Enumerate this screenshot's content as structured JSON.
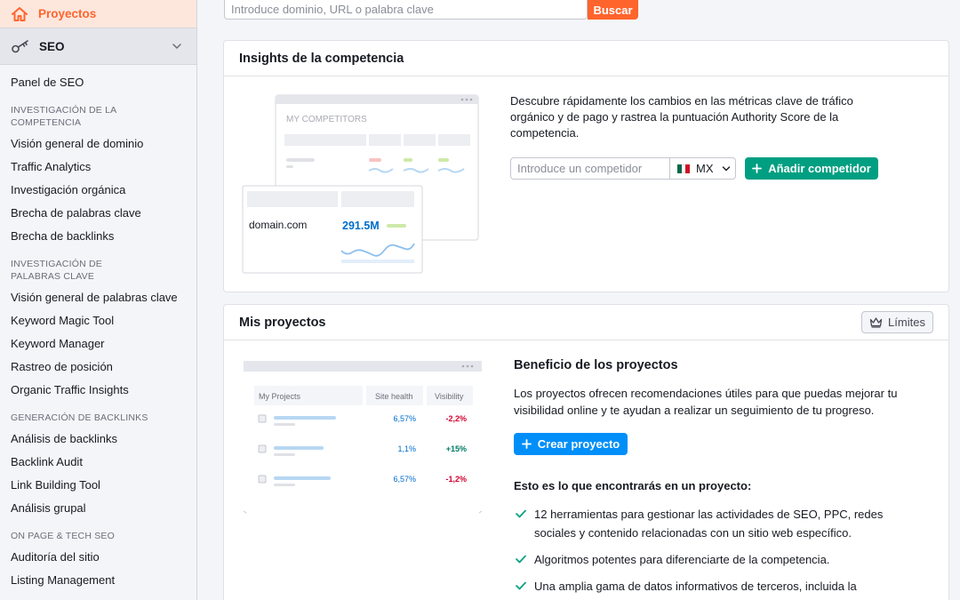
{
  "sidebar": {
    "projects_label": "Proyectos",
    "seo_label": "SEO",
    "items": [
      {
        "type": "item",
        "label": "Panel de SEO"
      },
      {
        "type": "section",
        "label": "INVESTIGACIÓN DE LA COMPETENCIA"
      },
      {
        "type": "item",
        "label": "Visión general de dominio"
      },
      {
        "type": "item",
        "label": "Traffic Analytics"
      },
      {
        "type": "item",
        "label": "Investigación orgánica"
      },
      {
        "type": "item",
        "label": "Brecha de palabras clave"
      },
      {
        "type": "item",
        "label": "Brecha de backlinks"
      },
      {
        "type": "section",
        "label": "INVESTIGACIÓN DE PALABRAS CLAVE"
      },
      {
        "type": "item",
        "label": "Visión general de palabras clave"
      },
      {
        "type": "item",
        "label": "Keyword Magic Tool"
      },
      {
        "type": "item",
        "label": "Keyword Manager"
      },
      {
        "type": "item",
        "label": "Rastreo de posición"
      },
      {
        "type": "item",
        "label": "Organic Traffic Insights"
      },
      {
        "type": "section",
        "label": "GENERACIÓN DE BACKLINKS"
      },
      {
        "type": "item",
        "label": "Análisis de backlinks"
      },
      {
        "type": "item",
        "label": "Backlink Audit"
      },
      {
        "type": "item",
        "label": "Link Building Tool"
      },
      {
        "type": "item",
        "label": "Análisis grupal"
      },
      {
        "type": "section",
        "label": "ON PAGE & TECH SEO"
      },
      {
        "type": "item",
        "label": "Auditoría del sitio"
      },
      {
        "type": "item",
        "label": "Listing Management"
      }
    ]
  },
  "search": {
    "placeholder": "Introduce dominio, URL o palabra clave",
    "button_label": "Buscar"
  },
  "insights": {
    "title": "Insights de la competencia",
    "description": "Descubre rápidamente los cambios en las métricas clave de tráfico orgánico y de pago y rastrea la puntuación Authority Score de la competencia.",
    "input_placeholder": "Introduce un competidor",
    "country": "MX",
    "add_button": "Añadir competidor",
    "illustration": {
      "header": "MY COMPETITORS",
      "domain": "domain.com",
      "value": "291.5M"
    }
  },
  "projects": {
    "title": "Mis proyectos",
    "limits_button": "Límites",
    "benefit_title": "Beneficio de los proyectos",
    "benefit_desc": "Los proyectos ofrecen recomendaciones útiles para que puedas mejorar tu visibilidad online y te ayudan a realizar un seguimiento de tu progreso.",
    "create_button": "Crear proyecto",
    "find_title": "Esto es lo que encontrarás en un proyecto:",
    "features": [
      "12 herramientas para gestionar las actividades de SEO, PPC, redes sociales y contenido relacionadas con un sitio web específico.",
      "Algoritmos potentes para diferenciarte de la competencia.",
      "Una amplia gama de datos informativos de terceros, incluida la"
    ],
    "illustration": {
      "col1": "My Projects",
      "col2": "Site health",
      "col3": "Visibility",
      "rows": [
        {
          "health": "6,57%",
          "visibility": "-2,2%"
        },
        {
          "health": "1,1%",
          "visibility": "+15%"
        },
        {
          "health": "6,57%",
          "visibility": "-1,2%"
        }
      ]
    }
  },
  "colors": {
    "accent_orange": "#ff642d",
    "green": "#009f81",
    "blue": "#008ff8"
  }
}
